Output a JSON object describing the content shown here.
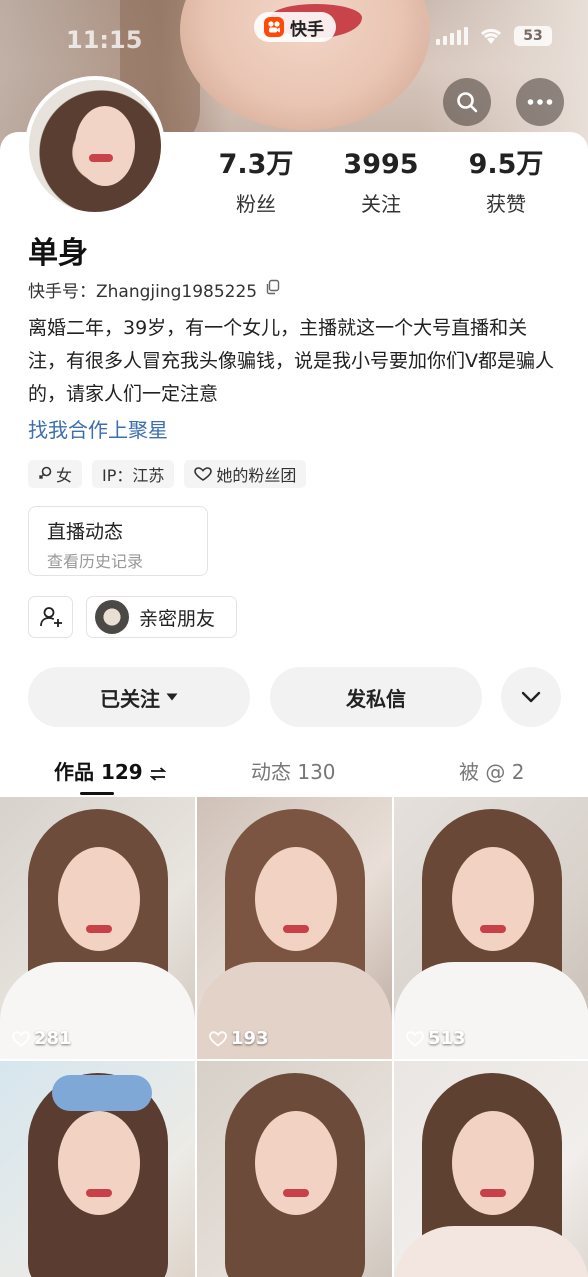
{
  "status_bar": {
    "time": "11:15",
    "battery": "53"
  },
  "brand": {
    "name": "快手",
    "accent": "#ff4906"
  },
  "profile": {
    "stats": [
      {
        "value": "7.3万",
        "label": "粉丝"
      },
      {
        "value": "3995",
        "label": "关注"
      },
      {
        "value": "9.5万",
        "label": "获赞"
      }
    ],
    "nickname": "单身",
    "user_id": "快手号：Zhangjing1985225",
    "bio": "离婚二年，39岁，有一个女儿，主播就这一个大号直播和关注，有很多人冒充我头像骗钱，说是我小号要加你们V都是骗人的，请家人们一定注意",
    "collab_link": "找我合作上聚星",
    "tags": [
      {
        "icon": "female-icon",
        "label": "女"
      },
      {
        "icon": "",
        "label": "IP：江苏"
      },
      {
        "icon": "heart-icon",
        "label": "她的粉丝团"
      }
    ],
    "live_box": {
      "title": "直播动态",
      "subtitle": "查看历史记录"
    },
    "close_friends": "亲密朋友"
  },
  "actions": {
    "follow": "已关注",
    "message": "发私信"
  },
  "tabs": [
    {
      "label": "作品 129",
      "active": true
    },
    {
      "label": "动态 130",
      "active": false
    },
    {
      "label": "被 @ 2",
      "active": false
    }
  ],
  "works": [
    {
      "likes": "281"
    },
    {
      "likes": "193"
    },
    {
      "likes": "513"
    },
    {
      "likes": ""
    },
    {
      "likes": ""
    },
    {
      "likes": ""
    }
  ],
  "colors": {
    "link": "#3d6fb0",
    "tag_bg": "#f4f4f5",
    "button_bg": "#f2f2f3"
  }
}
